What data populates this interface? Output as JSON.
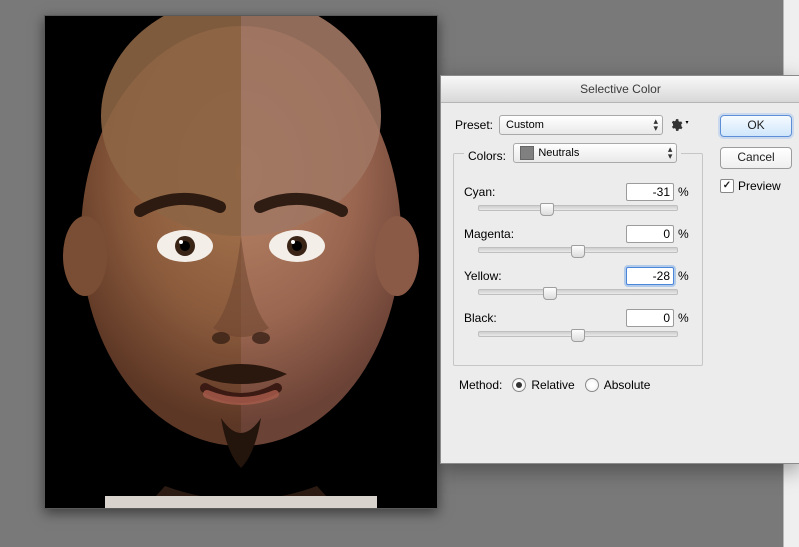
{
  "dialog": {
    "title": "Selective Color",
    "ok": "OK",
    "cancel": "Cancel",
    "preview_label": "Preview",
    "preview_checked": true,
    "preset_label": "Preset:",
    "preset_value": "Custom",
    "colors_label": "Colors:",
    "colors_value": "Neutrals",
    "sliders": {
      "cyan": {
        "label": "Cyan:",
        "value": "-31",
        "min": -100,
        "max": 100,
        "focused": false
      },
      "magenta": {
        "label": "Magenta:",
        "value": "0",
        "min": -100,
        "max": 100,
        "focused": false
      },
      "yellow": {
        "label": "Yellow:",
        "value": "-28",
        "min": -100,
        "max": 100,
        "focused": true
      },
      "black": {
        "label": "Black:",
        "value": "0",
        "min": -100,
        "max": 100,
        "focused": false
      }
    },
    "method_label": "Method:",
    "method_relative": "Relative",
    "method_absolute": "Absolute",
    "method_selected": "relative",
    "percent": "%"
  }
}
